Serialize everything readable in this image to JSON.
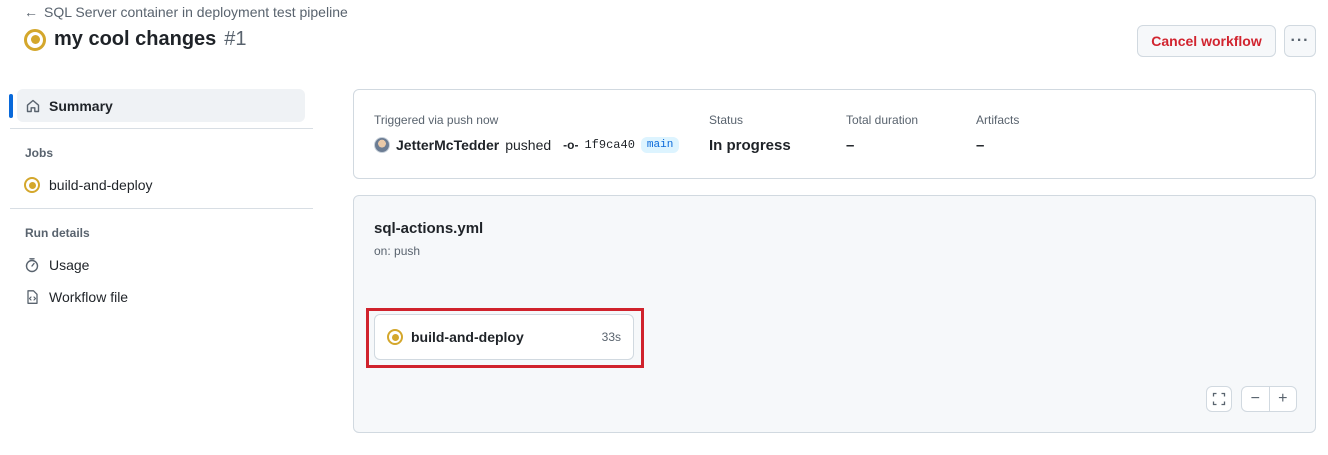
{
  "header": {
    "back_label": "SQL Server container in deployment test pipeline",
    "title": "my cool changes",
    "run_number": "#1",
    "cancel_label": "Cancel workflow",
    "more_label": "···"
  },
  "sidebar": {
    "summary_label": "Summary",
    "jobs_heading": "Jobs",
    "jobs": [
      {
        "label": "build-and-deploy",
        "status": "in-progress"
      }
    ],
    "run_details_heading": "Run details",
    "run_details": [
      {
        "label": "Usage",
        "icon": "stopwatch-icon"
      },
      {
        "label": "Workflow file",
        "icon": "file-code-icon"
      }
    ]
  },
  "summary": {
    "trigger_label": "Triggered via push now",
    "actor": "JetterMcTedder",
    "action": "pushed",
    "commit_sha": "1f9ca40",
    "branch": "main",
    "status_label": "Status",
    "status_value": "In progress",
    "duration_label": "Total duration",
    "duration_value": "–",
    "artifacts_label": "Artifacts",
    "artifacts_value": "–"
  },
  "graph": {
    "workflow_file": "sql-actions.yml",
    "trigger": "on: push",
    "job_name": "build-and-deploy",
    "job_duration": "33s",
    "zoom_out_label": "−",
    "zoom_in_label": "+"
  },
  "colors": {
    "in_progress": "#d4a72c",
    "danger": "#d1242f",
    "accent": "#0969da",
    "highlight_box": "#d0222c"
  }
}
